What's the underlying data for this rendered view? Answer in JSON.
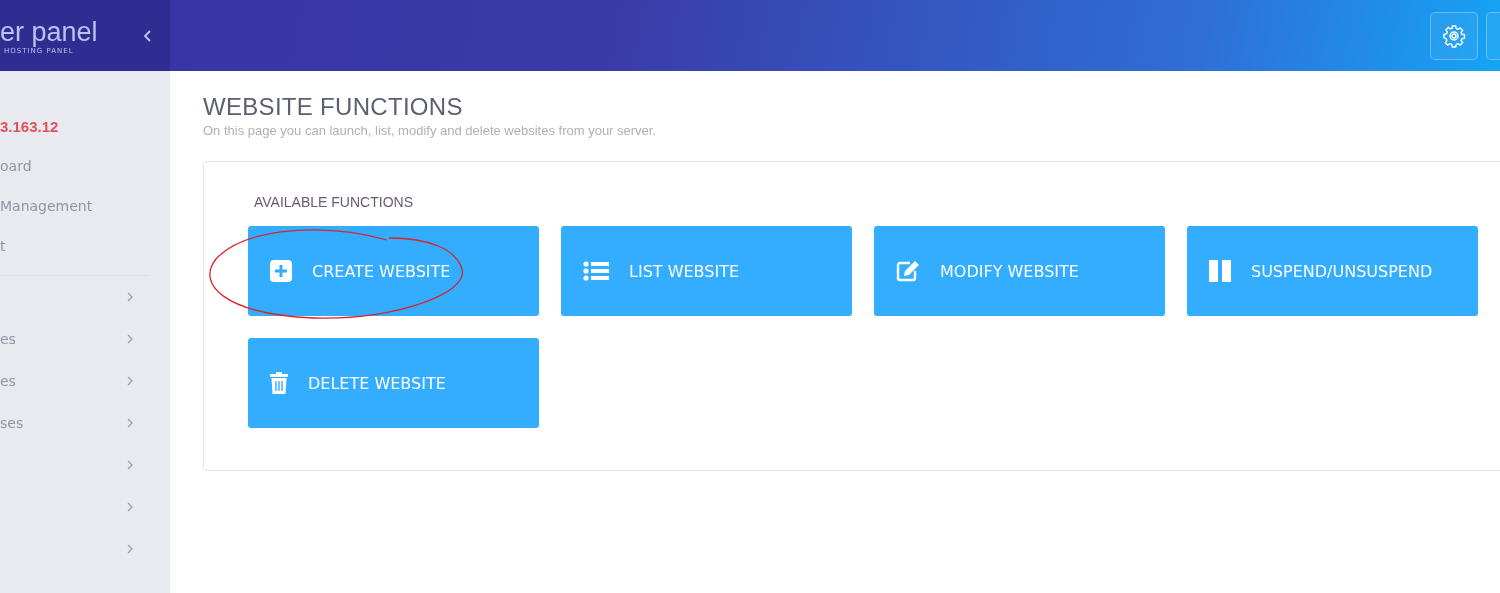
{
  "brand": {
    "name": "er panel",
    "tagline": "HOSTING PANEL"
  },
  "sidebar": {
    "ip": "3.163.12",
    "items": [
      {
        "label": "oard"
      },
      {
        "label": "Management"
      },
      {
        "label": "t"
      }
    ],
    "menu": [
      {
        "expandable": true
      },
      {
        "label": "es",
        "expandable": true
      },
      {
        "label": "es",
        "expandable": true
      },
      {
        "label": "ses",
        "expandable": true
      },
      {
        "expandable": true
      },
      {
        "expandable": true
      },
      {
        "expandable": true
      }
    ]
  },
  "page": {
    "title": "WEBSITE FUNCTIONS",
    "subtitle": "On this page you can launch, list, modify and delete websites from your server.",
    "section": "AVAILABLE FUNCTIONS",
    "functions": [
      {
        "kind": "create",
        "label": "CREATE WEBSITE",
        "highlighted": true
      },
      {
        "kind": "list",
        "label": "LIST WEBSITE",
        "highlighted": false
      },
      {
        "kind": "modify",
        "label": "MODIFY WEBSITE",
        "highlighted": false
      },
      {
        "kind": "suspend",
        "label": "SUSPEND/UNSUSPEND",
        "highlighted": false
      },
      {
        "kind": "delete",
        "label": "DELETE WEBSITE",
        "highlighted": false
      }
    ]
  }
}
